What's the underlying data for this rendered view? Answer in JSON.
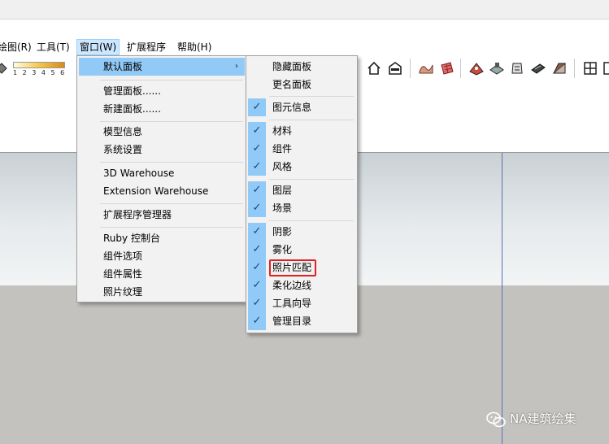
{
  "menubar": {
    "items": [
      {
        "label": "绘图(R)"
      },
      {
        "label": "工具(T)"
      },
      {
        "label": "窗口(W)"
      },
      {
        "label": "扩展程序"
      },
      {
        "label": "帮助(H)"
      }
    ]
  },
  "toolbar": {
    "ruler_numbers": "1 2 3 4 5 6"
  },
  "window_menu": {
    "items": [
      {
        "label": "默认面板"
      },
      {
        "label": "管理面板......"
      },
      {
        "label": "新建面板......"
      },
      {
        "label": "模型信息"
      },
      {
        "label": "系统设置"
      },
      {
        "label": "3D Warehouse"
      },
      {
        "label": "Extension Warehouse"
      },
      {
        "label": "扩展程序管理器"
      },
      {
        "label": "Ruby 控制台"
      },
      {
        "label": "组件选项"
      },
      {
        "label": "组件属性"
      },
      {
        "label": "照片纹理"
      }
    ]
  },
  "panel_submenu": {
    "items": [
      {
        "label": "隐藏面板",
        "checked": false
      },
      {
        "label": "更名面板",
        "checked": false
      },
      {
        "label": "图元信息",
        "checked": true
      },
      {
        "label": "材料",
        "checked": true
      },
      {
        "label": "组件",
        "checked": true
      },
      {
        "label": "风格",
        "checked": true
      },
      {
        "label": "图层",
        "checked": true
      },
      {
        "label": "场景",
        "checked": true
      },
      {
        "label": "阴影",
        "checked": true
      },
      {
        "label": "雾化",
        "checked": true
      },
      {
        "label": "照片匹配",
        "checked": true
      },
      {
        "label": "柔化边线",
        "checked": true
      },
      {
        "label": "工具向导",
        "checked": true
      },
      {
        "label": "管理目录",
        "checked": true
      }
    ],
    "check_glyph": "✓",
    "arrow_glyph": "›"
  },
  "watermark": {
    "text": "NA建筑绘集",
    "icon": "wechat-icon"
  },
  "colors": {
    "menu_highlight": "#91c9f7",
    "active_menubar": "#cce8ff",
    "annotation_red": "#e02020",
    "axis_blue": "#5c6fb8"
  }
}
